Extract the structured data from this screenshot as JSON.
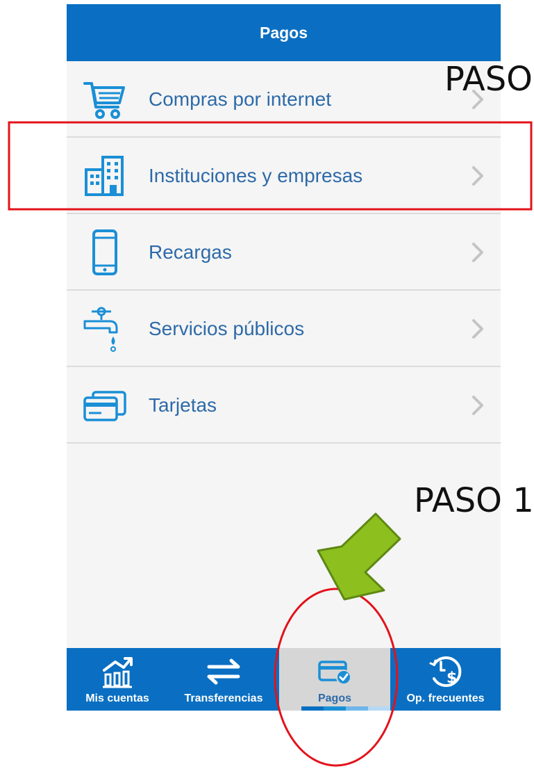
{
  "header": {
    "title": "Pagos"
  },
  "menu": {
    "items": [
      {
        "label": "Compras por internet",
        "icon": "shopping-cart-icon"
      },
      {
        "label": "Instituciones y empresas",
        "icon": "building-icon"
      },
      {
        "label": "Recargas",
        "icon": "mobile-phone-icon"
      },
      {
        "label": "Servicios públicos",
        "icon": "water-faucet-icon"
      },
      {
        "label": "Tarjetas",
        "icon": "credit-cards-icon"
      }
    ]
  },
  "tabbar": {
    "items": [
      {
        "label": "Mis cuentas",
        "icon": "bank-chart-icon"
      },
      {
        "label": "Transferencias",
        "icon": "swap-arrows-icon"
      },
      {
        "label": "Pagos",
        "icon": "card-check-icon",
        "active": true
      },
      {
        "label": "Op. frecuentes",
        "icon": "clock-dollar-icon"
      }
    ]
  },
  "annotations": {
    "step_top": "PASO",
    "step_bottom": "PASO 1"
  },
  "colors": {
    "brand_blue": "#0a6fc2",
    "label_blue": "#2d6aa8",
    "highlight_red": "#e3121b",
    "arrow_green": "#8dbf1e"
  }
}
